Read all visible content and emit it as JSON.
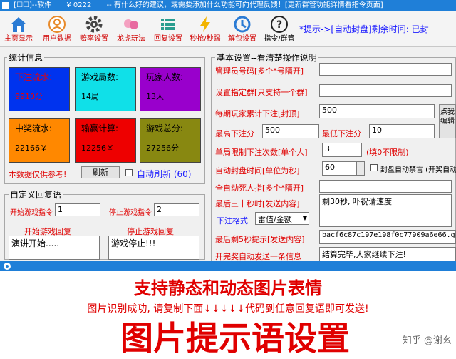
{
  "title_bar": {
    "app": "[☐☐]--软件",
    "version": "¥ 0222",
    "slogan": "-- 有什么好的建议，或需要添加什么功能可向代理反馈！[更新群管功能详情看指令页面]"
  },
  "toolbar": [
    {
      "label": "主页显示",
      "icon": "home-icon"
    },
    {
      "label": "用户数据",
      "icon": "user-icon"
    },
    {
      "label": "赔率设置",
      "icon": "gear-icon"
    },
    {
      "label": "龙虎玩法",
      "icon": "dragon-tiger-icon"
    },
    {
      "label": "回复设置",
      "icon": "list-icon"
    },
    {
      "label": "秒抢/秒踢",
      "icon": "flash-icon"
    },
    {
      "label": "解包设置",
      "icon": "package-icon"
    },
    {
      "label": "指令/群管",
      "icon": "question-icon"
    }
  ],
  "marquee": "*提示->[自动封盘]剩余时间: 已封",
  "stats": {
    "title": "统计信息",
    "cards": [
      {
        "label": "下注流水:",
        "value": "9910分",
        "bg": "#0033ee",
        "fg": "#ee0000"
      },
      {
        "label": "游戏局数:",
        "value": "14局",
        "bg": "#10e0e8",
        "fg": "#000000"
      },
      {
        "label": "玩家人数:",
        "value": "13人",
        "bg": "#9900cc",
        "fg": "#000000"
      },
      {
        "label": "中奖流水:",
        "value": "22166￥",
        "bg": "#ff8800",
        "fg": "#000000"
      },
      {
        "label": "输赢计算:",
        "value": "12256￥",
        "bg": "#ee0000",
        "fg": "#000000"
      },
      {
        "label": "游戏总分:",
        "value": "27256分",
        "bg": "#888811",
        "fg": "#000000"
      }
    ],
    "note": "本数据仅供参考!",
    "refresh_button": "刷新",
    "auto_refresh": "自动刷新 (60)"
  },
  "custom_reply": {
    "title": "自定义回复语",
    "start_cmd_label": "开始游戏指令",
    "start_cmd_value": "1",
    "stop_cmd_label": "停止游戏指令",
    "stop_cmd_value": "2",
    "start_reply_label": "开始游戏回复",
    "start_reply_value": "演讲开始.....",
    "stop_reply_label": "停止游戏回复",
    "stop_reply_value": "游戏停止!!!"
  },
  "basic": {
    "title": "基本设置--看清楚操作说明",
    "admin_label": "管理员号码[多个*号隔开]",
    "group_label": "设置指定群[只支持一个群]",
    "cap_label": "每期玩家累计下注[封顶]",
    "cap_value": "500",
    "max_label": "最高下注分",
    "max_value": "500",
    "min_label": "最低下注分",
    "min_value": "10",
    "limit_label": "单局限制下注次数[单个人]",
    "limit_value": "3",
    "limit_hint": "(填0不限制)",
    "close_label": "自动封盘时间[单位为秒]",
    "close_value": "60",
    "close_check": "封盘自动禁言 (开奖自动解",
    "at_label": "全自动死人指[多个*隔开]",
    "last30_label": "最后三十秒时[发送内容]",
    "last30_value": "剩30秒, 吓祝请速度",
    "bet_format_label": "下注格式",
    "bet_format_value": "雷值/金额",
    "last5_label": "最后剩5秒提示[发送内容]",
    "last5_value": "bacf6c87c197e198f0c77909a6e66.gi",
    "auto_send_label": "开完奖自动发送一条信息",
    "auto_send_value": "结算完毕,大家继续下注!",
    "side_button": "点我编辑"
  },
  "overlay": {
    "heading": "支持静态和动态图片表情",
    "instruction": "图片识别成功, 请复制下面↓↓↓↓↓代码到任意回复语即可发送!",
    "big_text": "图片提示语设置",
    "watermark": "知乎 @谢幺"
  }
}
